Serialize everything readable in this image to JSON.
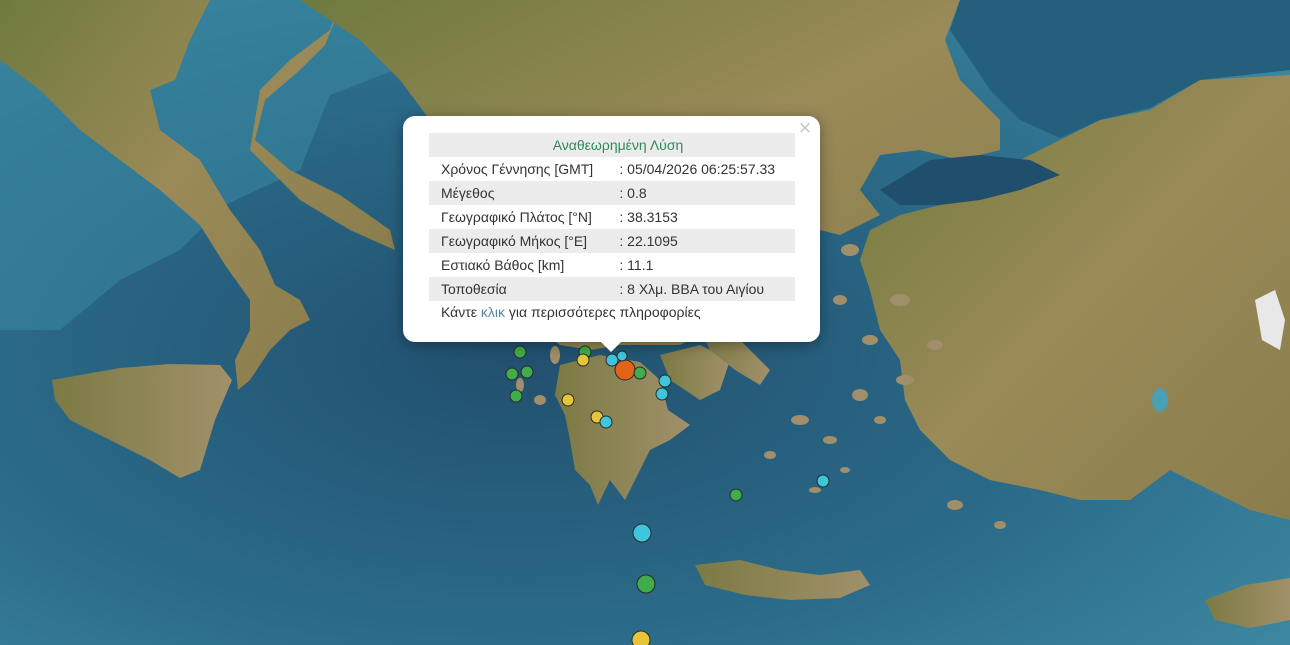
{
  "popup": {
    "title": "Αναθεωρημένη Λύση",
    "close_icon": "×",
    "rows": [
      {
        "label": "Χρόνος Γέννησης [GMT]",
        "value": ": 05/04/2026 06:25:57.33"
      },
      {
        "label": "Μέγεθος",
        "value": ": 0.8"
      },
      {
        "label": "Γεωγραφικό Πλάτος [°N]",
        "value": ": 38.3153"
      },
      {
        "label": "Γεωγραφικό Μήκος [°E]",
        "value": ": 22.1095"
      },
      {
        "label": "Εστιακό Βάθος [km]",
        "value": ": 11.1"
      },
      {
        "label": "Τοποθεσία",
        "value": ": 8 Χλμ. ΒΒΑ του Αιγίου"
      }
    ],
    "more_prefix": "Κάντε ",
    "more_link": "κλικ",
    "more_suffix": " για περισσότερες πληροφορίες"
  },
  "colors": {
    "sea": "#2d6e8c",
    "land": "#8a8450",
    "highlight": "#e0641a",
    "cyan": "#3ec6dc",
    "green": "#3fae4a",
    "yellow": "#e6c53a"
  }
}
